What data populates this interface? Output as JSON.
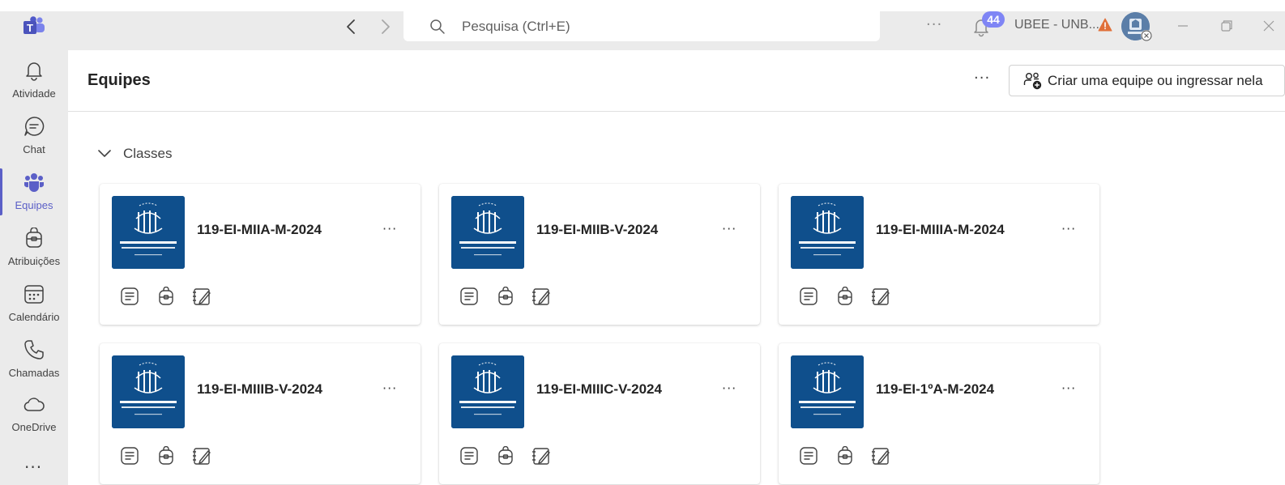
{
  "titlebar": {
    "search_placeholder": "Pesquisa (Ctrl+E)",
    "more": "···",
    "notification_count": "44",
    "tenant": "UBEE - UNB...",
    "icons": [
      "teams-logo",
      "back-arrow",
      "forward-arrow",
      "search-icon",
      "bell-icon",
      "warning-icon",
      "avatar",
      "minimize-icon",
      "maximize-icon",
      "close-icon"
    ]
  },
  "sidebar": {
    "items": [
      {
        "label": "Atividade",
        "icon": "bell-icon"
      },
      {
        "label": "Chat",
        "icon": "chat-icon"
      },
      {
        "label": "Equipes",
        "icon": "teams-icon",
        "active": true
      },
      {
        "label": "Atribuições",
        "icon": "backpack-icon"
      },
      {
        "label": "Calendário",
        "icon": "calendar-icon"
      },
      {
        "label": "Chamadas",
        "icon": "phone-icon"
      },
      {
        "label": "OneDrive",
        "icon": "cloud-icon"
      }
    ],
    "more": "···"
  },
  "header": {
    "title": "Equipes",
    "more": "···",
    "create_label": "Criar uma equipe ou ingressar nela"
  },
  "section": {
    "title": "Classes"
  },
  "cards": [
    {
      "name": "119-EI-MIIA-M-2024"
    },
    {
      "name": "119-EI-MIIB-V-2024"
    },
    {
      "name": "119-EI-MIIIA-M-2024"
    },
    {
      "name": "119-EI-MIIIB-V-2024"
    },
    {
      "name": "119-EI-MIIIC-V-2024"
    },
    {
      "name": "119-EI-1ºA-M-2024"
    }
  ],
  "card_more": "···",
  "colors": {
    "accent": "#5b5fc7",
    "badge": "#7f85f5",
    "team_logo_bg": "#0f4f8c",
    "warning": "#e0703a",
    "chrome_bg": "#ebebeb"
  }
}
